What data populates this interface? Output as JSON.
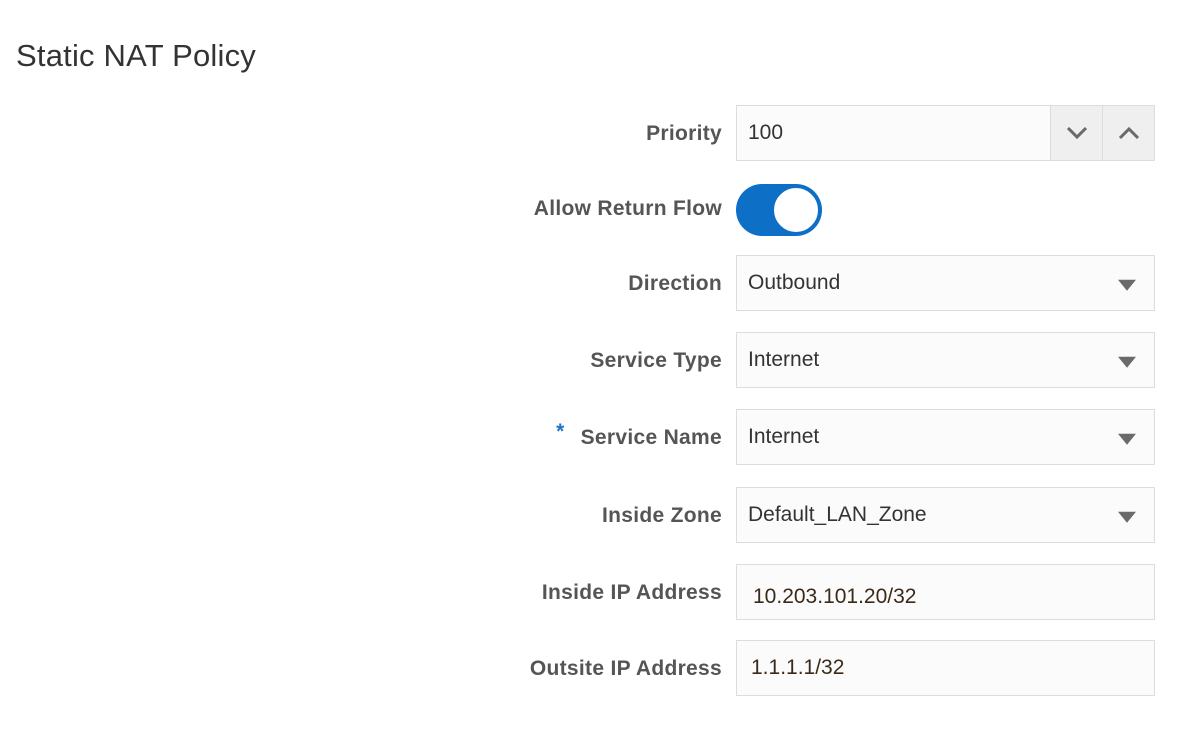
{
  "page": {
    "title": "Static NAT Policy"
  },
  "form": {
    "priority": {
      "label": "Priority",
      "value": "100"
    },
    "allow_return_flow": {
      "label": "Allow Return Flow",
      "enabled": true
    },
    "direction": {
      "label": "Direction",
      "value": "Outbound"
    },
    "service_type": {
      "label": "Service Type",
      "value": "Internet"
    },
    "service_name": {
      "required_mark": "*",
      "label": "Service Name",
      "value": "Internet"
    },
    "inside_zone": {
      "label": "Inside Zone",
      "value": "Default_LAN_Zone"
    },
    "inside_ip": {
      "label": "Inside IP Address",
      "value": "10.203.101.20/32"
    },
    "outside_ip": {
      "label": "Outsite IP Address",
      "value": "1.1.1.1/32"
    }
  },
  "icons": {
    "stepper_down": "chevron-down-icon",
    "stepper_up": "chevron-up-icon",
    "dropdown": "caret-down-icon"
  },
  "colors": {
    "accent": "#0d6fc6",
    "required": "#1f72c4",
    "label": "#555555",
    "border": "#dcdcdc"
  }
}
